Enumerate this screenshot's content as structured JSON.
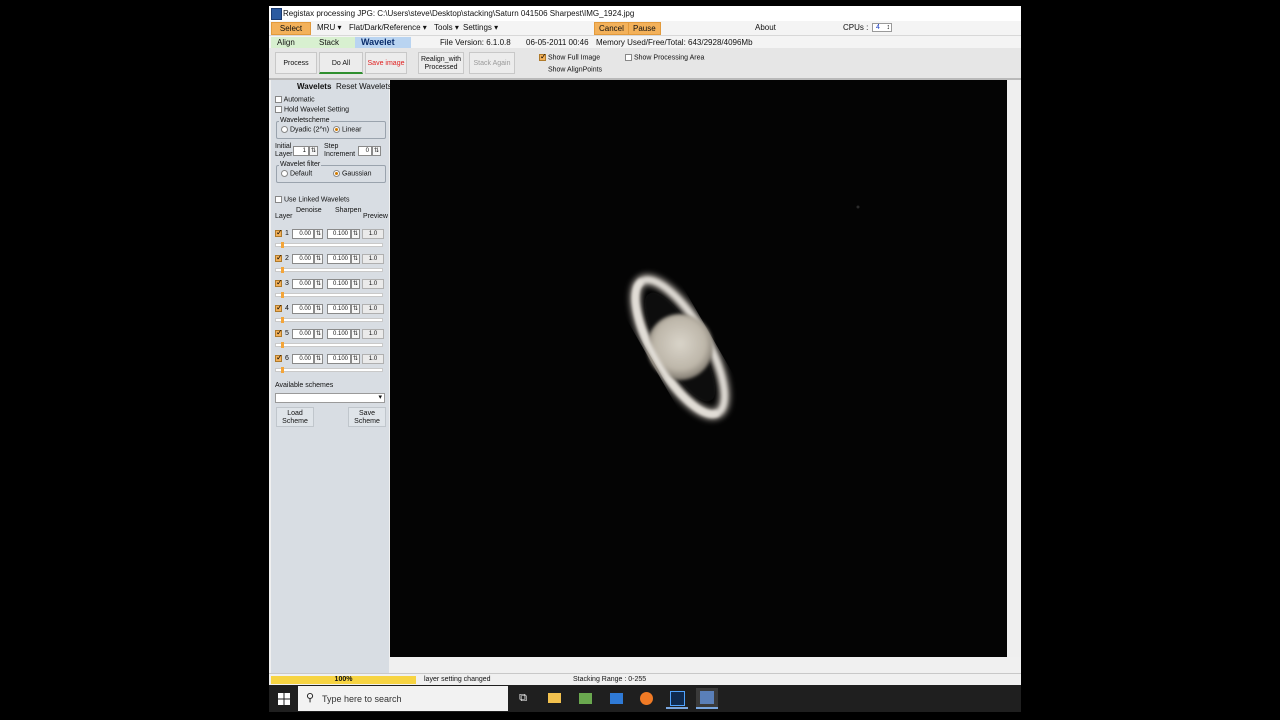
{
  "window": {
    "title": "Registax processing JPG: C:\\Users\\steve\\Desktop\\stacking\\Saturn 041506 Sharpest\\IMG_1924.jpg"
  },
  "menu": {
    "select": "Select",
    "mru": "MRU ▾",
    "flat_dark": "Flat/Dark/Reference ▾",
    "tools": "Tools ▾",
    "settings": "Settings ▾",
    "cancel": "Cancel",
    "pause": "Pause",
    "about": "About",
    "cpus_label": "CPUs :",
    "cpus_value": "4"
  },
  "tabs": {
    "align": "Align",
    "stack": "Stack",
    "wavelet": "Wavelet",
    "file_version": "File Version: 6.1.0.8",
    "date": "06-05-2011 00:46",
    "memory": "Memory Used/Free/Total: 643/2928/4096Mb"
  },
  "toolbar": {
    "process": "Process",
    "do_all": "Do All",
    "save_image": "Save image",
    "realign_line1": "Realign_with",
    "realign_line2": "Processed",
    "stack_again": "Stack Again",
    "show_full_image": "Show Full Image",
    "show_alignpoints": "Show AlignPoints",
    "show_processing_area": "Show Processing Area"
  },
  "wavelets": {
    "heading": "Wavelets",
    "reset": "Reset Wavelets",
    "automatic": "Automatic",
    "hold": "Hold Wavelet Setting",
    "scheme_title": "Waveletscheme",
    "dyadic": "Dyadic (2^n)",
    "linear": "Linear",
    "initial_layer_l1": "Initial",
    "initial_layer_l2": "Layer",
    "initial_layer_value": "1",
    "step_l1": "Step",
    "step_l2": "Increment",
    "step_value": "0",
    "filter_title": "Wavelet filter",
    "default": "Default",
    "gaussian": "Gaussian",
    "use_linked": "Use Linked Wavelets",
    "col_layer": "Layer",
    "col_denoise": "Denoise",
    "col_sharpen": "Sharpen",
    "col_preview": "Preview",
    "layers": [
      {
        "num": "1",
        "denoise": "0.00",
        "sharpen": "0.100",
        "preview": "1.0"
      },
      {
        "num": "2",
        "denoise": "0.00",
        "sharpen": "0.100",
        "preview": "1.0"
      },
      {
        "num": "3",
        "denoise": "0.00",
        "sharpen": "0.100",
        "preview": "1.0"
      },
      {
        "num": "4",
        "denoise": "0.00",
        "sharpen": "0.100",
        "preview": "1.0"
      },
      {
        "num": "5",
        "denoise": "0.00",
        "sharpen": "0.100",
        "preview": "1.0"
      },
      {
        "num": "6",
        "denoise": "0.00",
        "sharpen": "0.100",
        "preview": "1.0"
      }
    ],
    "available_schemes": "Available schemes",
    "load_l1": "Load",
    "load_l2": "Scheme",
    "save_l1": "Save",
    "save_l2": "Scheme"
  },
  "status": {
    "progress": "100%",
    "message": "layer setting changed",
    "range": "Stacking Range : 0-255"
  },
  "taskbar": {
    "search_placeholder": "Type here to search"
  }
}
